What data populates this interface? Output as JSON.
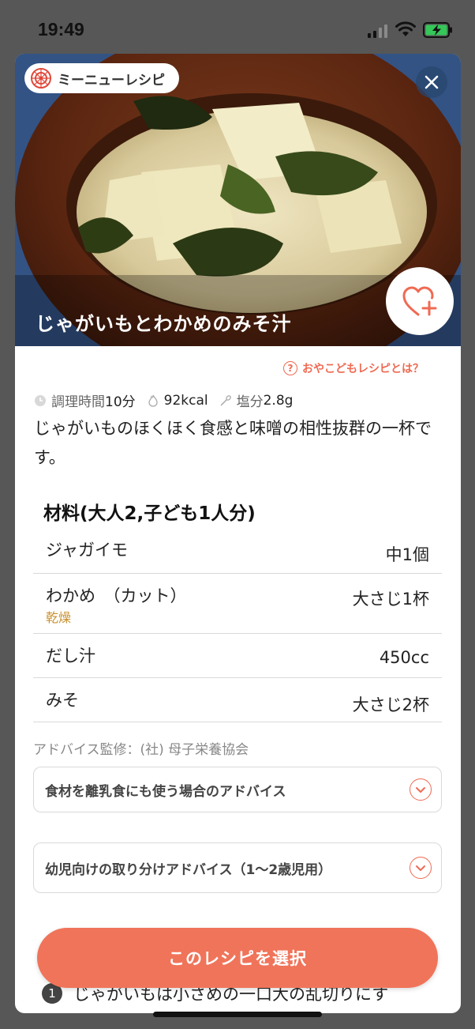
{
  "status_bar": {
    "time": "19:49"
  },
  "recipe": {
    "brand": "ミーニューレシピ",
    "title": "じゃがいもとわかめのみそ汁",
    "help_link": "おやこどもレシピとは？",
    "meta": {
      "time_label": "調理時間",
      "time_value": "10分",
      "kcal_value": "92kcal",
      "salt_label": "塩分",
      "salt_value": "2.8g"
    },
    "description": "じゃがいものほくほく食感と味噌の相性抜群の一杯です。",
    "ingredients_title": "材料(大人2,子ども1人分)",
    "ingredients": [
      {
        "name": "ジャガイモ",
        "note": "",
        "amount": "中1個"
      },
      {
        "name": "わかめ　（カット）",
        "note": "乾燥",
        "amount": "大さじ1杯"
      },
      {
        "name": "だし汁",
        "note": "",
        "amount": "450cc"
      },
      {
        "name": "みそ",
        "note": "",
        "amount": "大さじ2杯"
      }
    ],
    "advice_credit": "アドバイス監修：(社) 母子栄養協会",
    "accordions": [
      {
        "label": "食材を離乳食にも使う場合のアドバイス"
      },
      {
        "label": "幼児向けの取り分けアドバイス（1〜2歳児用）"
      }
    ],
    "step_1": {
      "number": "1",
      "text": "じゃがいもは小さめの一口大の乱切りにす"
    },
    "select_button": "このレシピを選択"
  },
  "colors": {
    "accent": "#f0745a",
    "note": "#c8902f",
    "overlay": "#575757"
  }
}
